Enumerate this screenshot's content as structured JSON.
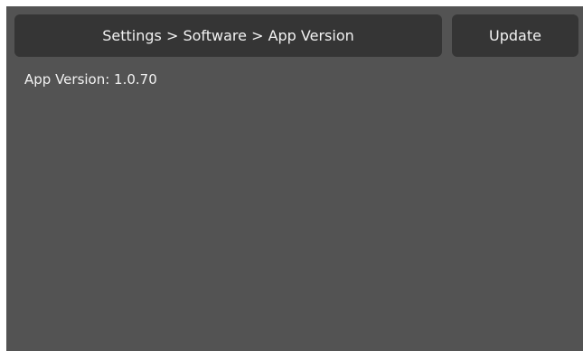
{
  "header": {
    "breadcrumb": "Settings > Software > App Version"
  },
  "actions": {
    "update_label": "Update"
  },
  "content": {
    "version_text": "App Version: 1.0.70"
  },
  "colors": {
    "background": "#535353",
    "panel": "#353535",
    "text": "#f2f2f2"
  }
}
